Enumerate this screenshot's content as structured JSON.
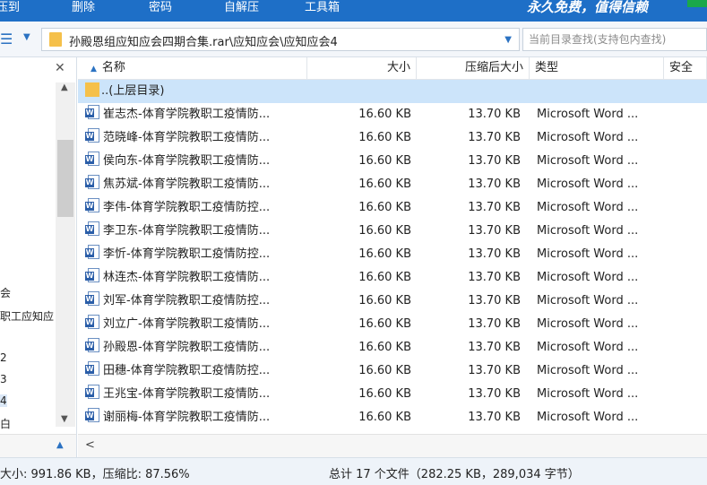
{
  "toolbar": {
    "items": [
      "压到",
      "删除",
      "密码",
      "自解压",
      "工具箱"
    ],
    "promo": "永久免费，值得信赖"
  },
  "address": {
    "path": "孙殿恩组应知应会四期合集.rar\\应知应会\\应知应会4",
    "search_placeholder": "当前目录查找(支持包内查找)"
  },
  "left_pane": {
    "tree_fragments": [
      "会",
      "职工应知应",
      "2",
      "3",
      "4",
      "白"
    ]
  },
  "columns": {
    "name": "名称",
    "size": "大小",
    "compressed": "压缩后大小",
    "type": "类型",
    "security": "安全"
  },
  "parent_dir": "..(上层目录)",
  "files": [
    {
      "name": "崔志杰-体育学院教职工疫情防...",
      "size": "16.60 KB",
      "compressed": "13.70 KB",
      "type": "Microsoft Word ..."
    },
    {
      "name": "范晓峰-体育学院教职工疫情防...",
      "size": "16.60 KB",
      "compressed": "13.70 KB",
      "type": "Microsoft Word ..."
    },
    {
      "name": "侯向东-体育学院教职工疫情防...",
      "size": "16.60 KB",
      "compressed": "13.70 KB",
      "type": "Microsoft Word ..."
    },
    {
      "name": "焦苏斌-体育学院教职工疫情防...",
      "size": "16.60 KB",
      "compressed": "13.70 KB",
      "type": "Microsoft Word ..."
    },
    {
      "name": "李伟-体育学院教职工疫情防控...",
      "size": "16.60 KB",
      "compressed": "13.70 KB",
      "type": "Microsoft Word ..."
    },
    {
      "name": "李卫东-体育学院教职工疫情防...",
      "size": "16.60 KB",
      "compressed": "13.70 KB",
      "type": "Microsoft Word ..."
    },
    {
      "name": "李忻-体育学院教职工疫情防控...",
      "size": "16.60 KB",
      "compressed": "13.70 KB",
      "type": "Microsoft Word ..."
    },
    {
      "name": "林连杰-体育学院教职工疫情防...",
      "size": "16.60 KB",
      "compressed": "13.70 KB",
      "type": "Microsoft Word ..."
    },
    {
      "name": "刘军-体育学院教职工疫情防控...",
      "size": "16.60 KB",
      "compressed": "13.70 KB",
      "type": "Microsoft Word ..."
    },
    {
      "name": "刘立广-体育学院教职工疫情防...",
      "size": "16.60 KB",
      "compressed": "13.70 KB",
      "type": "Microsoft Word ..."
    },
    {
      "name": "孙殿恩-体育学院教职工疫情防...",
      "size": "16.60 KB",
      "compressed": "13.70 KB",
      "type": "Microsoft Word ..."
    },
    {
      "name": "田穗-体育学院教职工疫情防控...",
      "size": "16.60 KB",
      "compressed": "13.70 KB",
      "type": "Microsoft Word ..."
    },
    {
      "name": "王兆宝-体育学院教职工疫情防...",
      "size": "16.60 KB",
      "compressed": "13.70 KB",
      "type": "Microsoft Word ..."
    },
    {
      "name": "谢丽梅-体育学院教职工疫情防...",
      "size": "16.60 KB",
      "compressed": "13.70 KB",
      "type": "Microsoft Word ..."
    }
  ],
  "status": {
    "left": "大小: 991.86 KB，压缩比: 87.56%",
    "right": "总计 17 个文件（282.25 KB，289,034 字节）"
  },
  "colors": {
    "toolbar_bg": "#1e6fc7",
    "selected_row": "#cce4fa",
    "accent": "#2b72c2"
  }
}
